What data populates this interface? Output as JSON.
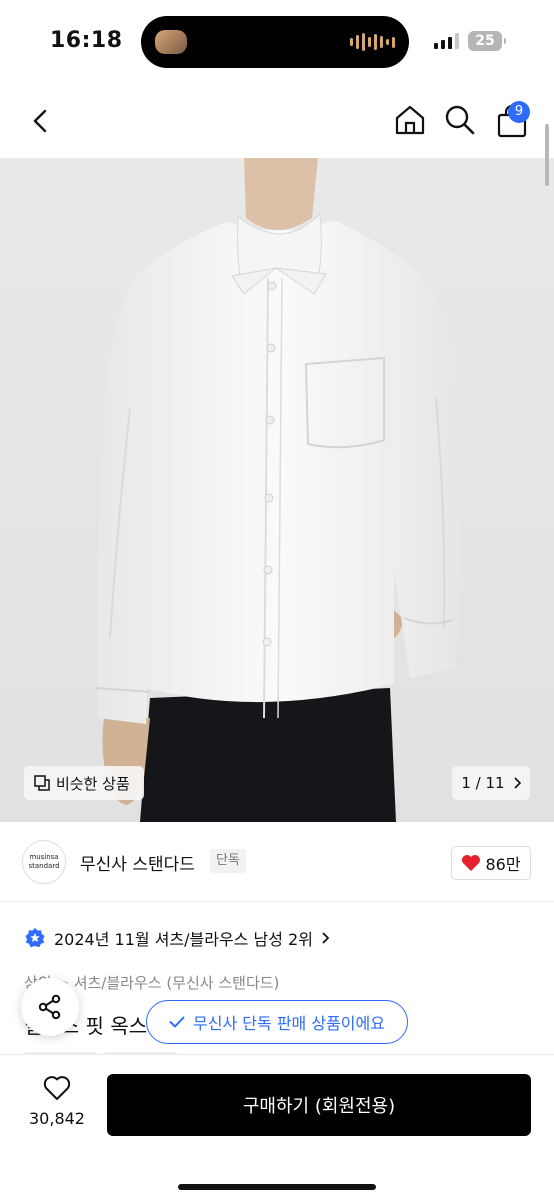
{
  "status_bar": {
    "time": "16:18",
    "battery": "25"
  },
  "nav": {
    "back_icon": "chevron-left-icon",
    "home_icon": "home-icon",
    "search_icon": "search-icon",
    "cart_icon": "shopping-bag-icon",
    "cart_badge": "9"
  },
  "image": {
    "similar_label": "비슷한 상품",
    "counter": "1 / 11"
  },
  "brand": {
    "logo_line1": "musinsa",
    "logo_line2": "standard",
    "name": "무신사 스탠다드",
    "tag": "단독",
    "likes": "86만"
  },
  "ranking": {
    "text": "2024년 11월 셔츠/블라우스 남성 2위"
  },
  "product": {
    "category": "상의 > 셔츠/블라우스 (무신사 스탠다드)",
    "title": "릴렉스 핏 옥스퍼드 셔츠"
  },
  "toast": {
    "text": "무신사 단독 판매 상품이에요"
  },
  "bottom": {
    "wish_count": "30,842",
    "buy_label": "구매하기 (회원전용)"
  },
  "colors": {
    "accent": "#2f6bff",
    "like_heart": "#e8202e",
    "buy_button": "#000000"
  }
}
